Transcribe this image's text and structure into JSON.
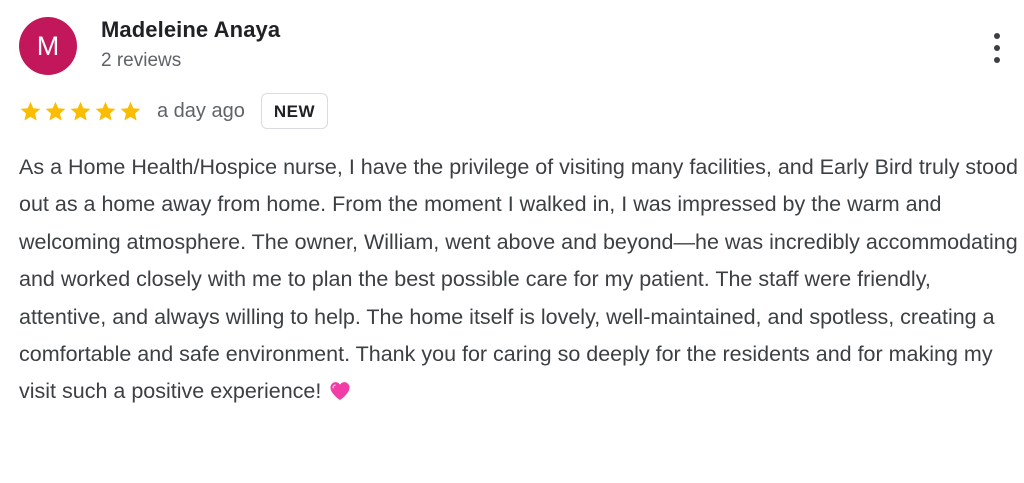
{
  "reviewer": {
    "avatar_initial": "M",
    "name": "Madeleine Anaya",
    "review_count": "2 reviews"
  },
  "review": {
    "rating": 5,
    "rating_max": 5,
    "date": "a day ago",
    "badge": "NEW",
    "text": "As a Home Health/Hospice nurse, I have the privilege of visiting many facilities, and Early Bird truly stood out as a home away from home. From the moment I walked in, I was impressed by the warm and welcoming atmosphere. The owner, William, went above and beyond—he was incredibly accommodating and worked closely with me to plan the best possible care for my patient. The staff were friendly, attentive, and always willing to help. The home itself is lovely, well-maintained, and spotless, creating a comfortable and safe environment. Thank you for caring so deeply for the residents and for making my visit such a positive experience!",
    "trailing_emoji": "pink-heart-icon"
  },
  "icons": {
    "more": "more-vert-icon",
    "star": "star-icon"
  },
  "colors": {
    "avatar_bg": "#c2185b",
    "star": "#fbbc04",
    "heart": "#f23ca6",
    "secondary_text": "#5f6368",
    "body_text": "#3c4043"
  }
}
